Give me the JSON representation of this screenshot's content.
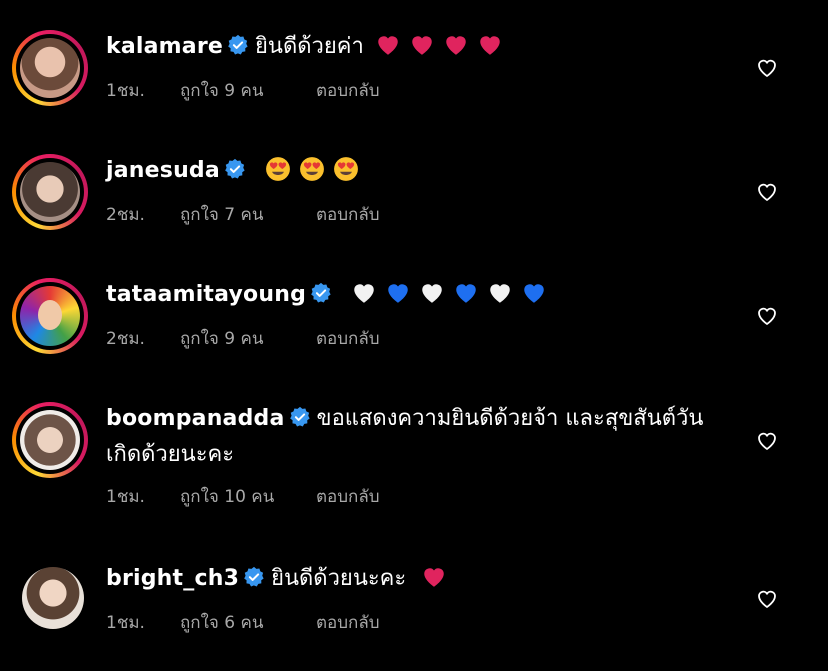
{
  "comments": [
    {
      "username": "kalamare",
      "text": "ยินดีด้วยค่า",
      "emojis": [
        "red-heart",
        "red-heart",
        "red-heart",
        "red-heart"
      ],
      "time": "1ชม.",
      "likes": "ถูกใจ 9 คน",
      "reply": "ตอบกลับ",
      "ring": true,
      "avatar_color": "#c79a86"
    },
    {
      "username": "janesuda",
      "text": "",
      "emojis": [
        "heart-eyes",
        "heart-eyes",
        "heart-eyes"
      ],
      "time": "2ชม.",
      "likes": "ถูกใจ 7 คน",
      "reply": "ตอบกลับ",
      "ring": true,
      "avatar_color": "#a58f85"
    },
    {
      "username": "tataamitayoung",
      "text": "",
      "emojis": [
        "white-heart",
        "blue-heart",
        "white-heart",
        "blue-heart",
        "white-heart",
        "blue-heart"
      ],
      "time": "2ชม.",
      "likes": "ถูกใจ 9 คน",
      "reply": "ตอบกลับ",
      "ring": true,
      "avatar_color": "#f3c44a"
    },
    {
      "username": "boompanadda",
      "text": "ขอแสดงความยินดีด้วยจ้า และสุขสันต์วันเกิดด้วยนะคะ",
      "emojis": [],
      "time": "1ชม.",
      "likes": "ถูกใจ 10 คน",
      "reply": "ตอบกลับ",
      "ring": true,
      "avatar_color": "#bfa38e"
    },
    {
      "username": "bright_ch3",
      "text": "ยินดีด้วยนะคะ",
      "emojis": [
        "red-heart"
      ],
      "time": "1ชม.",
      "likes": "ถูกใจ 6 คน",
      "reply": "ตอบกลับ",
      "ring": false,
      "avatar_color": "#d9c9b8"
    }
  ],
  "colors": {
    "background": "#000000",
    "verified": "#3897f0",
    "meta_text": "#a8a8a8"
  }
}
